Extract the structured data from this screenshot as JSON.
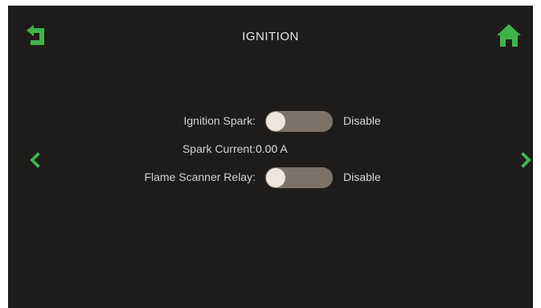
{
  "header": {
    "title": "IGNITION"
  },
  "colors": {
    "accent_green": "#3fb34a",
    "background": "#1e1c1b",
    "toggle_track": "#7c7267",
    "toggle_knob": "#ebe6df"
  },
  "icons": {
    "back": "back-arrow-icon",
    "home": "home-icon",
    "prev": "chevron-left-icon",
    "next": "chevron-right-icon"
  },
  "settings": {
    "ignition_spark": {
      "label": "Ignition Spark:",
      "state": "Disable"
    },
    "spark_current": {
      "label": "Spark Current:",
      "value": "0.00 A"
    },
    "flame_scanner_relay": {
      "label": "Flame Scanner Relay:",
      "state": "Disable"
    }
  }
}
